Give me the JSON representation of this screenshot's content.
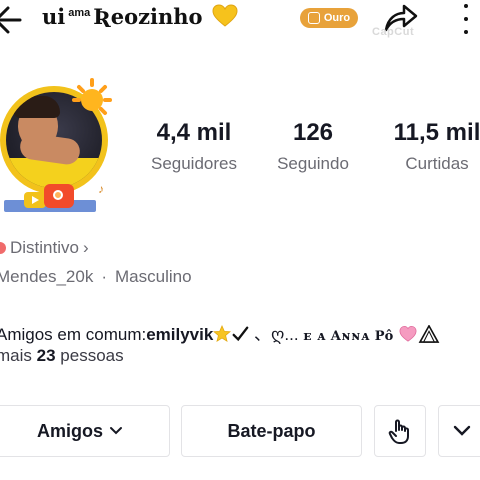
{
  "header": {
    "title_prefix": "ui",
    "title_sup": "ama",
    "title_name": "Ʀeozinho",
    "badge_label": "Ouro",
    "watermark": "CapCut"
  },
  "stats": [
    {
      "value": "4,4 mil",
      "label": "Seguidores"
    },
    {
      "value": "126",
      "label": "Seguindo"
    },
    {
      "value": "11,5 mil",
      "label": "Curtidas"
    }
  ],
  "profile": {
    "badge_text": "Distintivo",
    "badge_chevron": "›",
    "username": "Mendes_20k",
    "gender": "Masculino",
    "separator": "·"
  },
  "mutual": {
    "prefix": "Amigos em comum:",
    "user1": "emilyvik",
    "middle": "、ღ...",
    "user2": "ᴇ ᴀ Aɴɴᴀ Pô",
    "more_prefix": "mais",
    "count": "23",
    "more_suffix": "pessoas"
  },
  "buttons": {
    "friends": "Amigos",
    "chat": "Bate-papo"
  },
  "colors": {
    "badge": "#e8a23a",
    "avatar_ring": "#f2c21b",
    "text_primary": "#161823",
    "text_secondary": "#6b6b73"
  },
  "icons": [
    "back-arrow-icon",
    "yellow-heart-icon",
    "share-icon",
    "more-vertical-icon",
    "star-icon",
    "check-icon",
    "pink-heart-icon",
    "triangle-icon",
    "chevron-down-icon",
    "profile-switch-icon"
  ]
}
